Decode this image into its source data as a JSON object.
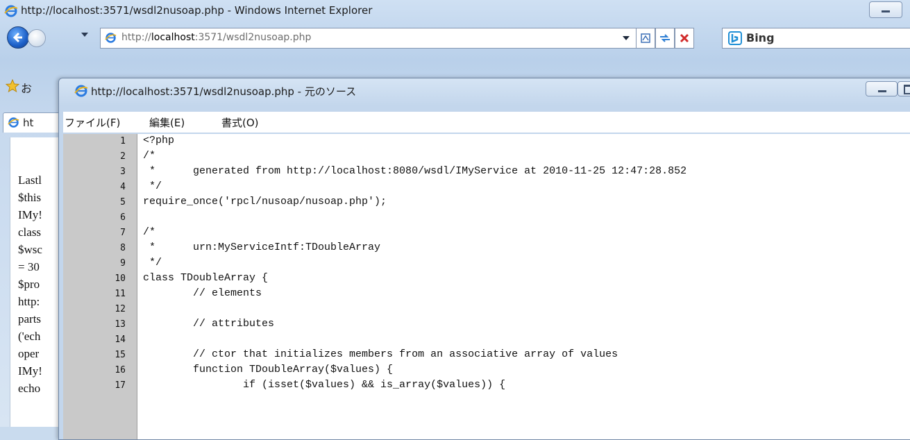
{
  "browser": {
    "title": "http://localhost:3571/wsdl2nusoap.php - Windows Internet Explorer",
    "address": {
      "prefix": "http://",
      "host": "localhost",
      "rest": ":3571/wsdl2nusoap.php"
    },
    "search_provider": "Bing",
    "favorites_partial": "お",
    "tab_partial": "ht",
    "page_partial_lines": [
      "Lastl",
      "$this",
      "IMy!",
      "class",
      "$wsc",
      "= 30",
      "$pro",
      "http:",
      "parts",
      "('ech",
      "oper",
      "IMy!",
      "echo"
    ]
  },
  "source_viewer": {
    "title": "http://localhost:3571/wsdl2nusoap.php - 元のソース",
    "menu": [
      "ファイル(F)",
      "編集(E)",
      "書式(O)"
    ],
    "line_numbers": [
      "1",
      "2",
      "3",
      "4",
      "5",
      "6",
      "7",
      "8",
      "9",
      "10",
      "11",
      "12",
      "13",
      "14",
      "15",
      "16",
      "17"
    ],
    "code_lines": [
      "<?php",
      "/*",
      " *      generated from http://localhost:8080/wsdl/IMyService at 2010-11-25 12:47:28.852",
      " */",
      "require_once('rpcl/nusoap/nusoap.php');",
      "",
      "/*",
      " *      urn:MyServiceIntf:TDoubleArray",
      " */",
      "class TDoubleArray {",
      "        // elements",
      "",
      "        // attributes",
      "",
      "        // ctor that initializes members from an associative array of values",
      "        function TDoubleArray($values) {",
      "                if (isset($values) && is_array($values)) {"
    ]
  }
}
